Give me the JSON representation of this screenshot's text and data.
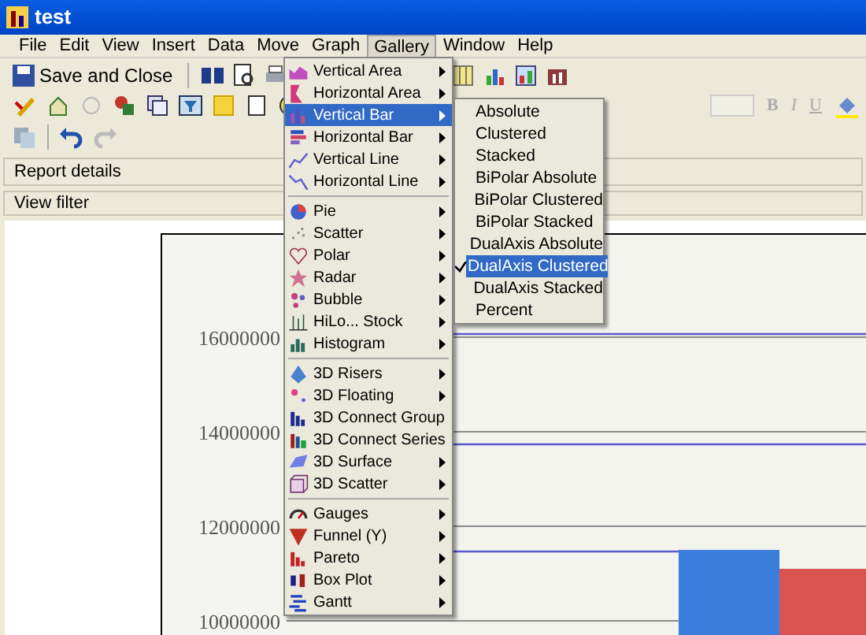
{
  "window": {
    "title": "test"
  },
  "menu_bar": [
    {
      "label": "File",
      "selected": false
    },
    {
      "label": "Edit",
      "selected": false
    },
    {
      "label": "View",
      "selected": false
    },
    {
      "label": "Insert",
      "selected": false
    },
    {
      "label": "Data",
      "selected": false
    },
    {
      "label": "Move",
      "selected": false
    },
    {
      "label": "Graph",
      "selected": false
    },
    {
      "label": "Gallery",
      "selected": true
    },
    {
      "label": "Window",
      "selected": false
    },
    {
      "label": "Help",
      "selected": false
    }
  ],
  "toolbar": {
    "save_button": "Save and Close",
    "format_buttons": [
      "B",
      "I",
      "U"
    ]
  },
  "panels": [
    "Report details",
    "View filter"
  ],
  "gallery_menu": {
    "groups": [
      [
        {
          "label": "Vertical Area",
          "selected": false
        },
        {
          "label": "Horizontal Area",
          "selected": false
        },
        {
          "label": "Vertical Bar",
          "selected": true
        },
        {
          "label": "Horizontal Bar",
          "selected": false
        },
        {
          "label": "Vertical Line",
          "selected": false
        },
        {
          "label": "Horizontal Line",
          "selected": false
        }
      ],
      [
        {
          "label": "Pie",
          "selected": false
        },
        {
          "label": "Scatter",
          "selected": false
        },
        {
          "label": "Polar",
          "selected": false
        },
        {
          "label": "Radar",
          "selected": false
        },
        {
          "label": "Bubble",
          "selected": false
        },
        {
          "label": "HiLo... Stock",
          "selected": false
        },
        {
          "label": "Histogram",
          "selected": false
        }
      ],
      [
        {
          "label": "3D Risers",
          "selected": false
        },
        {
          "label": "3D Floating",
          "selected": false
        },
        {
          "label": "3D Connect Group",
          "selected": false
        },
        {
          "label": "3D Connect Series",
          "selected": false
        },
        {
          "label": "3D Surface",
          "selected": false
        },
        {
          "label": "3D Scatter",
          "selected": false
        }
      ],
      [
        {
          "label": "Gauges",
          "selected": false
        },
        {
          "label": "Funnel (Y)",
          "selected": false
        },
        {
          "label": "Pareto",
          "selected": false
        },
        {
          "label": "Box Plot",
          "selected": false
        },
        {
          "label": "Gantt",
          "selected": false
        }
      ]
    ]
  },
  "vertical_bar_submenu": [
    {
      "label": "Absolute",
      "selected": false,
      "checked": false
    },
    {
      "label": "Clustered",
      "selected": false,
      "checked": false
    },
    {
      "label": "Stacked",
      "selected": false,
      "checked": false
    },
    {
      "label": "BiPolar Absolute",
      "selected": false,
      "checked": false
    },
    {
      "label": "BiPolar Clustered",
      "selected": false,
      "checked": false
    },
    {
      "label": "BiPolar Stacked",
      "selected": false,
      "checked": false
    },
    {
      "label": "DualAxis Absolute",
      "selected": false,
      "checked": false
    },
    {
      "label": "DualAxis Clustered",
      "selected": true,
      "checked": true
    },
    {
      "label": "DualAxis Stacked",
      "selected": false,
      "checked": false
    },
    {
      "label": "Percent",
      "selected": false,
      "checked": false
    }
  ],
  "chart": {
    "chart_data": {
      "type": "bar",
      "stacked": false,
      "grid": true,
      "ylim": [
        9600000,
        18200000
      ],
      "yticks": [
        10000000,
        12000000,
        14000000,
        16000000
      ],
      "series": [
        {
          "color": "#3b7ddd",
          "values": [
            11500000
          ]
        },
        {
          "color": "#d9534f",
          "values": [
            11100000
          ]
        }
      ]
    }
  }
}
